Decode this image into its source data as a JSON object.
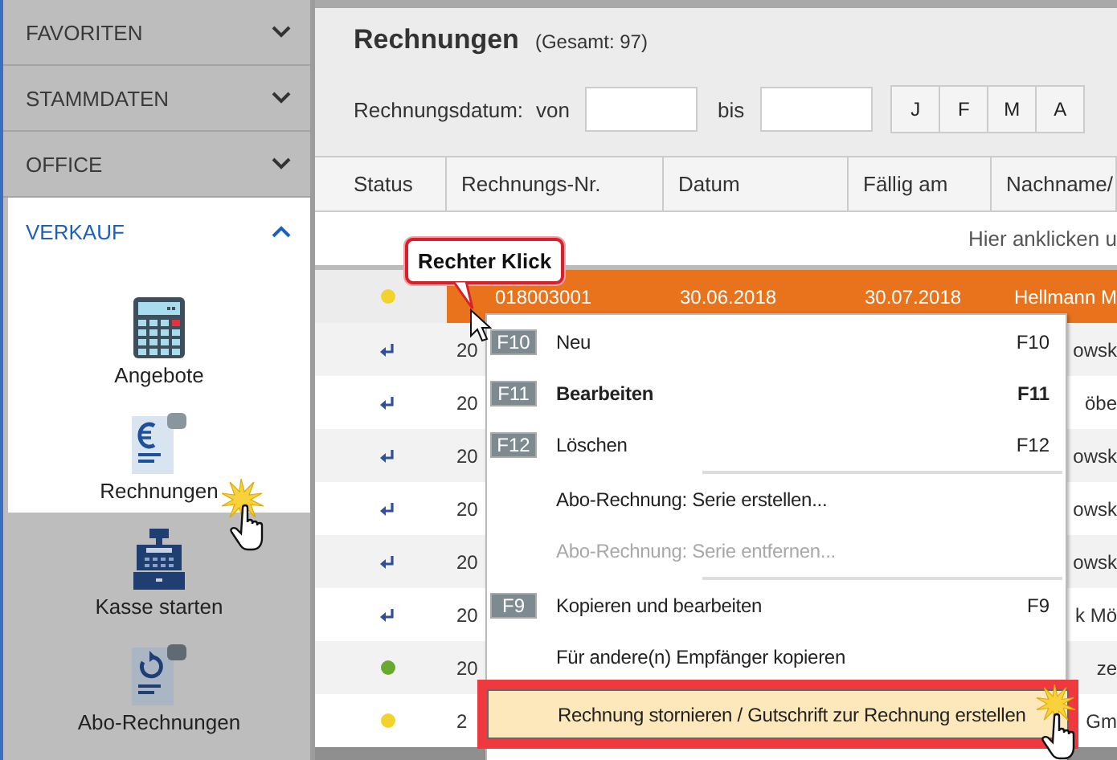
{
  "sidebar": {
    "sections": [
      {
        "label": "FAVORITEN",
        "expanded": false
      },
      {
        "label": "STAMMDATEN",
        "expanded": false
      },
      {
        "label": "OFFICE",
        "expanded": false
      },
      {
        "label": "VERKAUF",
        "expanded": true,
        "items": [
          {
            "label": "Angebote",
            "kind": "calculator",
            "spotlit": true
          },
          {
            "label": "Rechnungen",
            "kind": "invoice",
            "spotlit": true
          },
          {
            "label": "Kasse starten",
            "kind": "register",
            "spotlit": false
          },
          {
            "label": "Abo-Rechnungen",
            "kind": "recurring",
            "spotlit": false
          }
        ]
      }
    ]
  },
  "main": {
    "title": "Rechnungen",
    "total": "(Gesamt: 97)",
    "filter": {
      "label": "Rechnungsdatum:",
      "from": "von",
      "to": "bis",
      "months": [
        "J",
        "F",
        "M",
        "A"
      ]
    },
    "table": {
      "columns": [
        "Status",
        "Rechnungs-Nr.",
        "Datum",
        "Fällig am",
        "Nachname/"
      ],
      "hint": "Hier anklicken u",
      "rows": [
        {
          "kind": "open",
          "number": "018003001",
          "date": "30.06.2018",
          "due": "30.07.2018",
          "name": "Hellmann M",
          "selected": true
        },
        {
          "kind": "recurring",
          "number": "20",
          "name": "owsk",
          "selected": false
        },
        {
          "kind": "recurring",
          "number": "20",
          "name": "öbe",
          "selected": false
        },
        {
          "kind": "recurring",
          "number": "20",
          "name": "owsk",
          "selected": false
        },
        {
          "kind": "recurring",
          "number": "20",
          "name": "owsk",
          "selected": false
        },
        {
          "kind": "recurring",
          "number": "20",
          "name": "owsk",
          "selected": false
        },
        {
          "kind": "recurring",
          "number": "20",
          "name": "k Mö",
          "selected": false
        },
        {
          "kind": "paid",
          "number": "20",
          "name": "ze",
          "selected": false
        },
        {
          "kind": "open",
          "number": "2",
          "name": "Gm",
          "selected": false
        }
      ]
    }
  },
  "callout": "Rechter Klick",
  "context_menu": [
    {
      "kind": "item",
      "badge": "F10",
      "label": "Neu",
      "shortcut": "F10",
      "bold": false,
      "disabled": false,
      "highlighted": false
    },
    {
      "kind": "item",
      "badge": "F11",
      "label": "Bearbeiten",
      "shortcut": "F11",
      "bold": true,
      "disabled": false,
      "highlighted": false
    },
    {
      "kind": "item",
      "badge": "F12",
      "label": "Löschen",
      "shortcut": "F12",
      "bold": false,
      "disabled": false,
      "highlighted": false
    },
    {
      "kind": "separator"
    },
    {
      "kind": "item",
      "label": "Abo-Rechnung: Serie erstellen...",
      "bold": false,
      "disabled": false,
      "highlighted": false
    },
    {
      "kind": "item",
      "label": "Abo-Rechnung: Serie entfernen...",
      "bold": false,
      "disabled": true,
      "highlighted": false
    },
    {
      "kind": "separator"
    },
    {
      "kind": "item",
      "badge": "F9",
      "label": "Kopieren und bearbeiten",
      "shortcut": "F9",
      "bold": false,
      "disabled": false,
      "highlighted": false
    },
    {
      "kind": "item",
      "label": "Für andere(n) Empfänger kopieren",
      "bold": false,
      "disabled": false,
      "highlighted": false
    },
    {
      "kind": "item",
      "label": "Rechnung stornieren / Gutschrift zur Rechnung erstellen",
      "bold": false,
      "disabled": false,
      "highlighted": true
    }
  ]
}
